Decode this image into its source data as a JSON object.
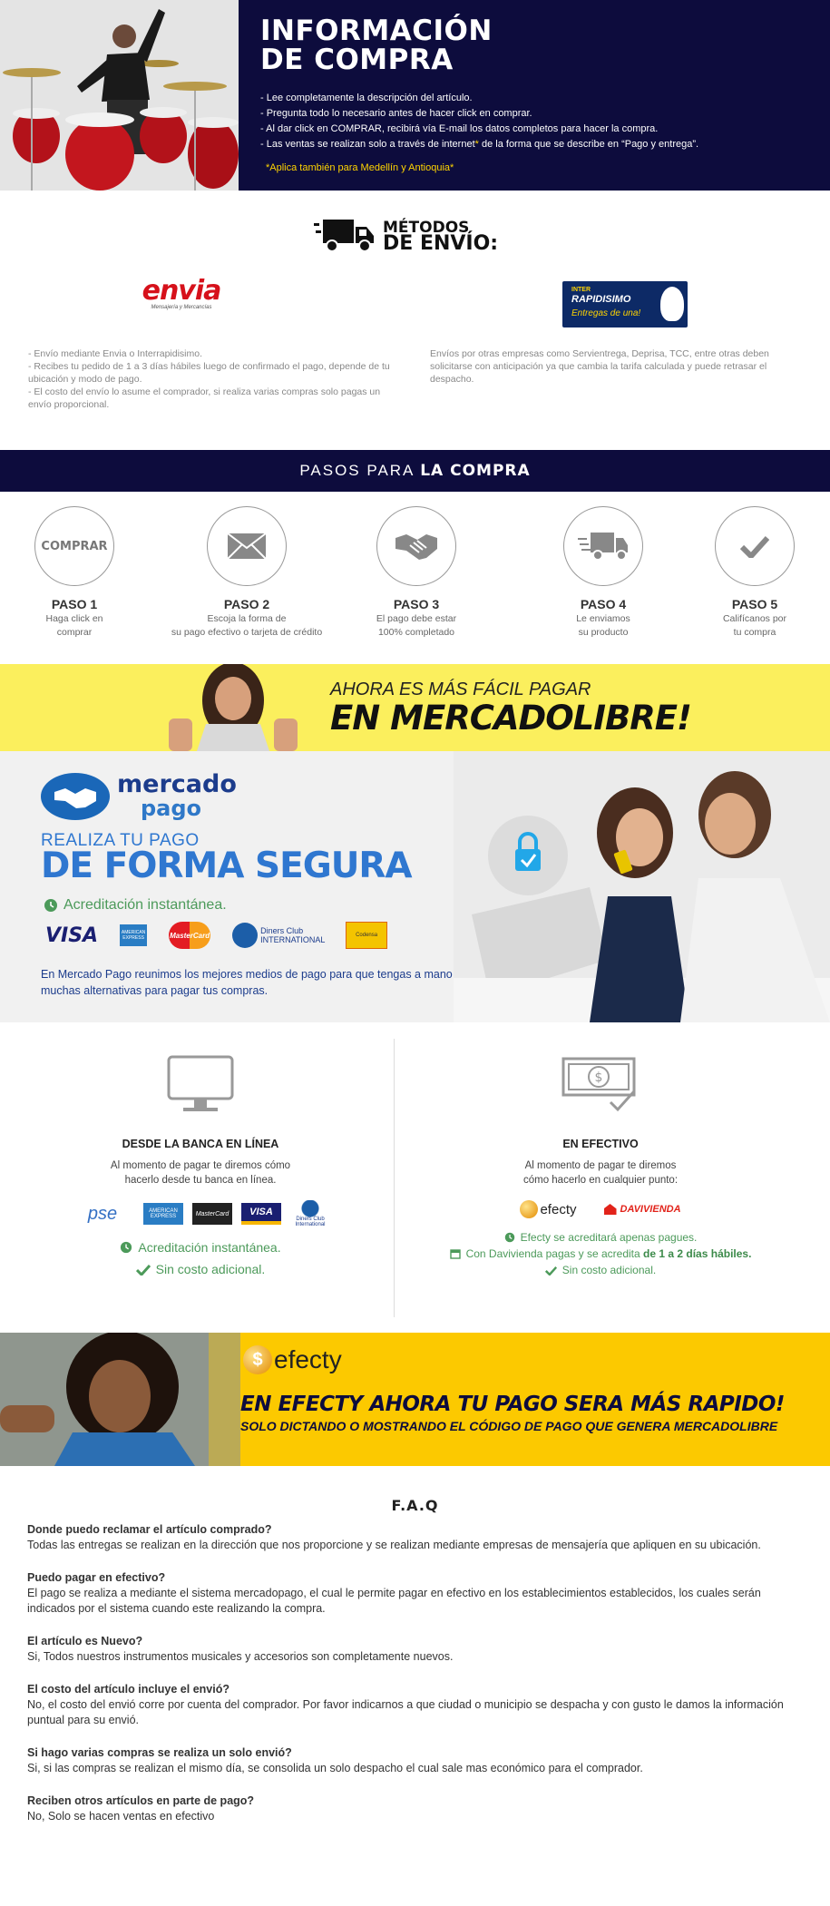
{
  "header": {
    "title_line1": "INFORMACIÓN",
    "title_line2": "DE COMPRA",
    "bullets": [
      "- Lee completamente la descripción del artículo.",
      "- Pregunta todo lo necesario antes de hacer click en comprar.",
      "- Al dar click en COMPRAR, recibirá vía E-mail los datos completos para hacer la compra."
    ],
    "bullet4_a": "- Las ventas se realizan solo a través de internet",
    "bullet4_star": "*",
    "bullet4_b": " de la forma que se describe en “Pago y entrega”.",
    "note": "*Aplica también para Medellín y Antioquia*"
  },
  "shipping": {
    "title_line1": "MÉTODOS",
    "title_line2": "DE ENVÍO:",
    "envia_logo": "envia",
    "envia_sub": "Mensajería y Mercancías",
    "inter_logo_1": "INTER",
    "inter_logo_2": "RAPIDISIMO",
    "inter_logo_3": "Entregas de una!",
    "left_text": [
      "- Envío mediante Envia o Interrapidisimo.",
      "- Recibes tu pedido de 1 a 3 días hábiles luego de confirmado el pago, depende de tu ubicación y modo de pago.",
      "- El costo del envío lo asume el comprador, si realiza varias compras solo pagas un envío proporcional."
    ],
    "right_text": "Envíos por otras empresas como Servientrega, Deprisa, TCC, entre otras deben solicitarse con anticipación ya que cambia la tarifa calculada y puede retrasar el despacho."
  },
  "steps": {
    "band_light": "PASOS PARA ",
    "band_bold": "LA COMPRA",
    "items": [
      {
        "icon": "comprar-text",
        "circle_text": "COMPRAR",
        "name": "PASO 1",
        "desc_1": "Haga click en",
        "desc_2": "comprar"
      },
      {
        "icon": "envelope-icon",
        "name": "PASO 2",
        "desc_1": "Escoja la forma de",
        "desc_2": "su pago efectivo o tarjeta de crédito"
      },
      {
        "icon": "handshake-icon",
        "name": "PASO 3",
        "desc_1": "El pago debe estar",
        "desc_2": "100% completado"
      },
      {
        "icon": "truck-icon",
        "name": "PASO 4",
        "desc_1": "Le enviamos",
        "desc_2": "su producto"
      },
      {
        "icon": "check-icon",
        "name": "PASO 5",
        "desc_1": "Califícanos por",
        "desc_2": "tu compra"
      }
    ]
  },
  "ml_banner": {
    "line1": "AHORA ES MÁS FÁCIL PAGAR",
    "line2": "EN MERCADOLIBRE!"
  },
  "mercadopago": {
    "logo_a": "mercado",
    "logo_b": "pago",
    "headline1": "REALIZA TU PAGO",
    "headline2": "DE FORMA SEGURA",
    "accreditation": "Acreditación instantánea.",
    "cards": [
      "VISA",
      "AMERICAN EXPRESS",
      "MasterCard",
      "Diners Club INTERNATIONAL",
      "Codensa"
    ],
    "description": "En Mercado Pago reunimos los mejores medios de pago para que tengas a mano muchas alternativas para pagar tus compras."
  },
  "payment": {
    "bank": {
      "title": "DESDE LA BANCA EN LÍNEA",
      "text_1": "Al momento de pagar te diremos cómo",
      "text_2": "hacerlo desde tu banca en línea.",
      "logos": [
        "pse",
        "AMERICAN EXPRESS",
        "MasterCard",
        "VISA",
        "Diners Club International"
      ],
      "check1": "Acreditación instantánea.",
      "check2": "Sin costo adicional."
    },
    "cash": {
      "title": "EN EFECTIVO",
      "text_1": "Al momento de pagar te diremos",
      "text_2": "cómo hacerlo en cualquier punto:",
      "logo1": "efecty",
      "logo2": "DAVIVIENDA",
      "check1": "Efecty se acreditará apenas pagues.",
      "check2_a": "Con Davivienda pagas y se acredita ",
      "check2_b": "de 1 a 2 días hábiles.",
      "check3": "Sin costo adicional."
    }
  },
  "efecty_banner": {
    "logo": "efecty",
    "line1": "EN EFECTY AHORA TU PAGO SERA MÁS RAPIDO!",
    "line2": "SOLO DICTANDO O MOSTRANDO EL CÓDIGO DE PAGO QUE GENERA MERCADOLIBRE"
  },
  "faq": {
    "title": "F.A.Q",
    "items": [
      {
        "q": "Donde puedo reclamar el artículo comprado?",
        "a": "Todas las entregas se realizan en la dirección que nos proporcione y se realizan mediante empresas de mensajería que apliquen en su ubicación."
      },
      {
        "q": "Puedo pagar en efectivo?",
        "a": "El pago se realiza a mediante el sistema mercadopago, el cual le permite pagar en efectivo en los establecimientos establecidos, los cuales serán indicados por el sistema cuando este realizando la compra."
      },
      {
        "q": "El artículo es Nuevo?",
        "a": "Si, Todos nuestros instrumentos musicales y accesorios son completamente nuevos."
      },
      {
        "q": "El costo del artículo incluye el envió?",
        "a": "No, el costo del envió corre por cuenta del comprador. Por favor indicarnos a que ciudad o municipio se despacha y con gusto le damos la información puntual para su envió."
      },
      {
        "q": "Si hago varias compras se realiza un solo envió?",
        "a": "Si, si las compras se realizan el mismo día, se consolida un solo despacho el cual sale mas económico para el comprador."
      },
      {
        "q": "Reciben otros artículos en parte de pago?",
        "a": "No, Solo se hacen ventas en efectivo"
      }
    ]
  },
  "colors": {
    "navy": "#0d0c3d",
    "yellow_banner": "#fbef5d",
    "efecty_yellow": "#fcc900",
    "mp_blue": "#2f77d0",
    "green": "#4c9a5a"
  }
}
